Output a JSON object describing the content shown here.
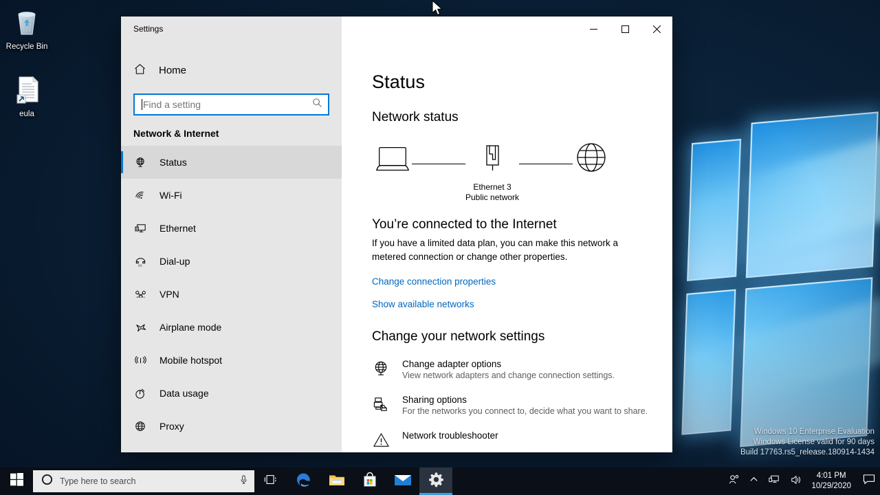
{
  "window": {
    "title": "Settings",
    "controls": {
      "minimize": "minimize-button",
      "maximize": "maximize-button",
      "close": "close-button"
    }
  },
  "sidebar": {
    "home_label": "Home",
    "search": {
      "value": "",
      "placeholder": "Find a setting",
      "icon": "search-icon"
    },
    "section_title": "Network & Internet",
    "items": [
      {
        "label": "Status",
        "icon": "globe-monitor-icon",
        "selected": true
      },
      {
        "label": "Wi-Fi",
        "icon": "wifi-icon",
        "selected": false
      },
      {
        "label": "Ethernet",
        "icon": "ethernet-icon",
        "selected": false
      },
      {
        "label": "Dial-up",
        "icon": "dialup-icon",
        "selected": false
      },
      {
        "label": "VPN",
        "icon": "vpn-icon",
        "selected": false
      },
      {
        "label": "Airplane mode",
        "icon": "airplane-icon",
        "selected": false
      },
      {
        "label": "Mobile hotspot",
        "icon": "hotspot-icon",
        "selected": false
      },
      {
        "label": "Data usage",
        "icon": "pie-chart-icon",
        "selected": false
      },
      {
        "label": "Proxy",
        "icon": "globe-icon",
        "selected": false
      }
    ]
  },
  "content": {
    "page_title": "Status",
    "network_status_heading": "Network status",
    "diagram": {
      "device_icon": "laptop-icon",
      "adapter_icon": "ethernet-plug-icon",
      "internet_icon": "globe-icon",
      "adapter_name": "Ethernet 3",
      "network_type": "Public network"
    },
    "connected_heading": "You’re connected to the Internet",
    "connected_description": "If you have a limited data plan, you can make this network a metered connection or change other properties.",
    "links": [
      "Change connection properties",
      "Show available networks"
    ],
    "change_settings_heading": "Change your network settings",
    "settings_items": [
      {
        "icon": "globe-monitor-icon",
        "title": "Change adapter options",
        "description": "View network adapters and change connection settings."
      },
      {
        "icon": "sharing-icon",
        "title": "Sharing options",
        "description": "For the networks you connect to, decide what you want to share."
      },
      {
        "icon": "warning-triangle-icon",
        "title": "Network troubleshooter",
        "description": ""
      }
    ]
  },
  "desktop": {
    "icons": [
      {
        "label": "Recycle Bin",
        "icon": "recycle-bin-icon"
      },
      {
        "label": "eula",
        "icon": "document-shortcut-icon"
      }
    ],
    "watermark": {
      "line1": "Windows 10 Enterprise Evaluation",
      "line2": "Windows License valid for 90 days",
      "line3": "Build 17763.rs5_release.180914-1434"
    }
  },
  "taskbar": {
    "start_icon": "windows-start-icon",
    "search": {
      "value": "",
      "placeholder": "Type here to search",
      "icon": "cortana-circle-icon",
      "mic_icon": "microphone-icon"
    },
    "taskview_icon": "task-view-icon",
    "apps": [
      {
        "name": "Microsoft Edge",
        "icon": "edge-icon",
        "active": false
      },
      {
        "name": "File Explorer",
        "icon": "file-explorer-icon",
        "active": false
      },
      {
        "name": "Microsoft Store",
        "icon": "microsoft-store-icon",
        "active": false
      },
      {
        "name": "Mail",
        "icon": "mail-icon",
        "active": false
      },
      {
        "name": "Settings",
        "icon": "settings-gear-icon",
        "active": true
      }
    ],
    "tray": {
      "people_icon": "people-icon",
      "chevron_icon": "chevron-up-icon",
      "network_icon": "network-icon",
      "volume_icon": "volume-icon",
      "action_center_icon": "action-center-icon",
      "time": "4:01 PM",
      "date": "10/29/2020"
    }
  },
  "colors": {
    "accent": "#0078D7",
    "link": "#0067C0",
    "sidebar_bg": "#E6E6E6",
    "taskbar_bg": "#0A0F18"
  }
}
